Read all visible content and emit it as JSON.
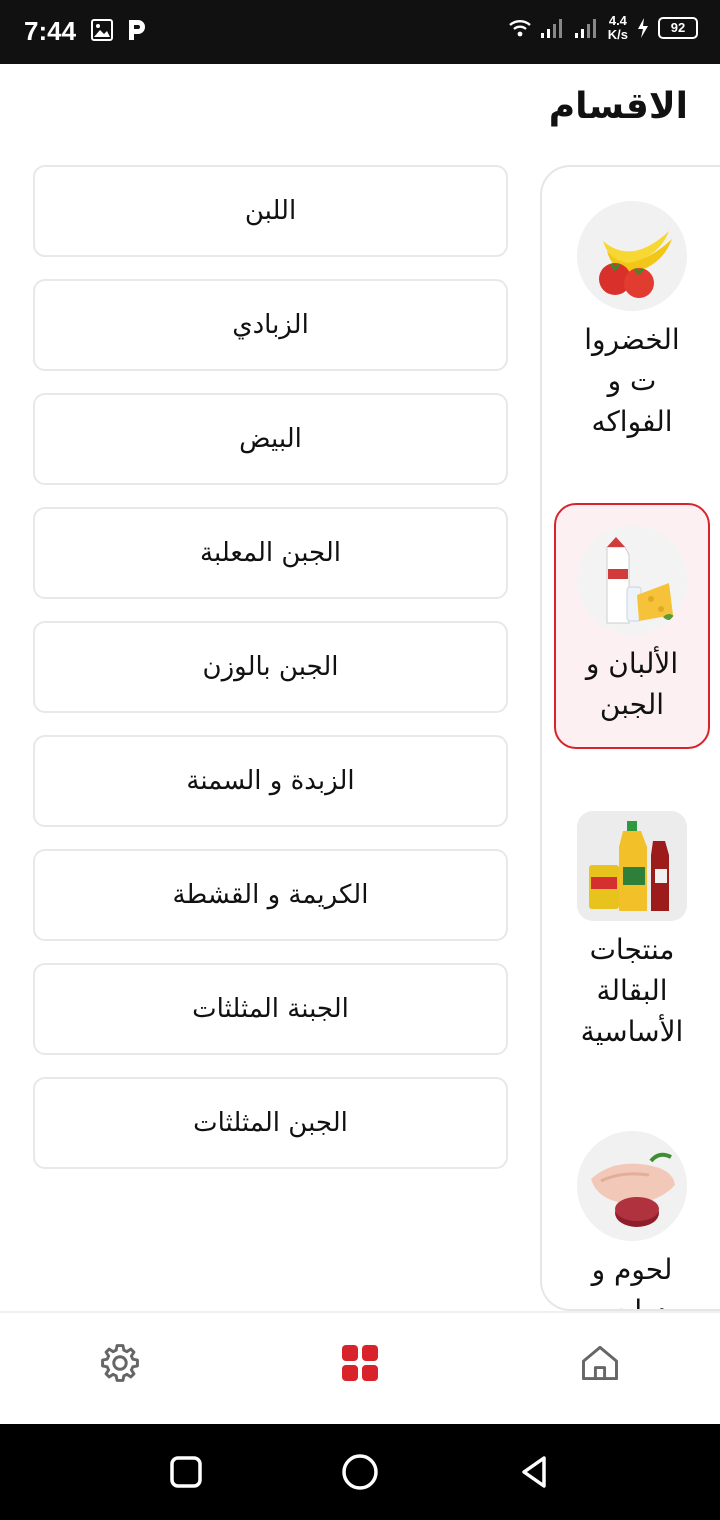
{
  "status_bar": {
    "time": "7:44",
    "net_speed_value": "4.4",
    "net_speed_unit": "K/s",
    "battery": "92"
  },
  "header": {
    "title": "الاقسام"
  },
  "categories": [
    {
      "label": "الخضروات و الفواكه",
      "lines": [
        "الخضروا",
        "ت و",
        "الفواكه"
      ],
      "icon": "fruits-vegetables-image",
      "selected": false
    },
    {
      "label": "الألبان و الجبن",
      "lines": [
        "الألبان و",
        "الجبن"
      ],
      "icon": "dairy-cheese-image",
      "selected": true
    },
    {
      "label": "منتجات البقالة الأساسية",
      "lines": [
        "منتجات",
        "البقالة",
        "الأساسية"
      ],
      "icon": "grocery-products-image",
      "selected": false
    },
    {
      "label": "لحوم و دواجن",
      "lines": [
        "لحوم و",
        "دواجن"
      ],
      "icon": "meat-poultry-image",
      "selected": false
    }
  ],
  "subcategories": [
    "اللبن",
    "الزبادي",
    "البيض",
    "الجبن المعلبة",
    "الجبن بالوزن",
    "الزبدة و السمنة",
    "الكريمة و القشطة",
    "الجبنة المثلثات",
    "الجبن المثلثات"
  ],
  "bottom_nav": [
    {
      "name": "settings",
      "icon": "gear-icon",
      "active": false
    },
    {
      "name": "categories",
      "icon": "grid-icon",
      "active": true
    },
    {
      "name": "home",
      "icon": "home-icon",
      "active": false
    }
  ],
  "colors": {
    "accent": "#d8232a",
    "selected_bg": "#fdf0f2",
    "border": "#e8e8e8",
    "icon_gray": "#666666"
  }
}
